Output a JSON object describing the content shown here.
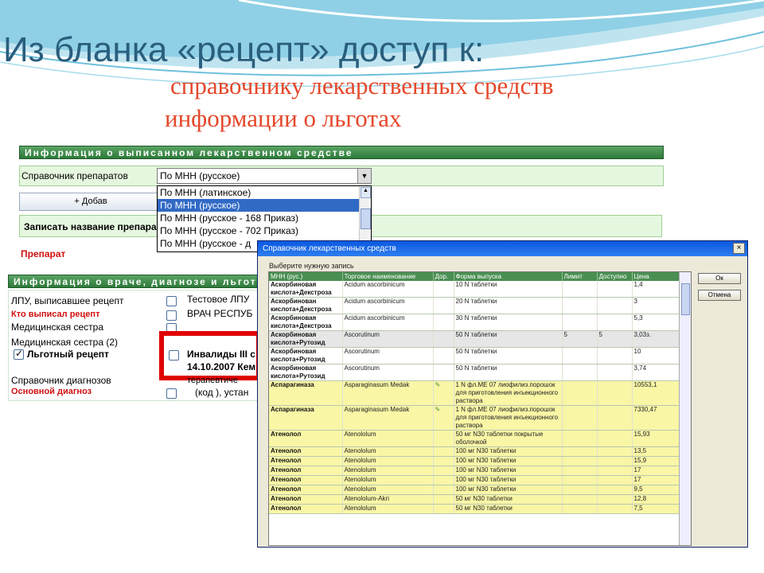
{
  "slide": {
    "title": "Из бланка «рецепт» доступ к:",
    "subtitle1": "справочнику лекарственных средств",
    "subtitle2": "информации о льготах"
  },
  "colors": {
    "title": "#2a5e7d",
    "subtitle": "#e4482a",
    "section_bar": "#3a8a45",
    "highlight_box": "#e00000"
  },
  "drug_section": {
    "header": "Информация о выписанном лекарственном средстве",
    "reference_label": "Справочник препаратов",
    "reference_value": "По МНН (русское)",
    "options": [
      "По МНН (латинское)",
      "По МНН (русское)",
      "По МНН (русское - 168 Приказ)",
      "По МНН (русское - 702 Приказ)",
      "По МНН (русское - д"
    ],
    "selected_index": 1,
    "add_button": "+ Добав",
    "record_label": "Записать название препара",
    "drug_label": "Препарат"
  },
  "doctor_section": {
    "header": "Информация о враче, диагнозе и льготе",
    "lpu_label": "ЛПУ, выписавшее рецепт",
    "lpu_value": "Тестовое ЛПУ",
    "prescriber_label": "Кто выписал рецепт",
    "prescriber_value": "ВРАЧ РЕСПУБ",
    "nurse_label": "Медицинская сестра",
    "nurse2_label": "Медицинская сестра (2)",
    "benefit_label": "Льготный рецепт",
    "benefit_line1": "Инвалиды III с",
    "benefit_line2": "14.10.2007 Кем",
    "diag_ref_label": "Справочник диагнозов",
    "diag_ref_value": "терапевтиче",
    "main_diag_label": "Основной диагноз",
    "main_diag_value": "(код ), устан"
  },
  "dialog": {
    "title": "Справочник лекарственных средств",
    "close": "×",
    "select_label": "Выберите нужную запись",
    "ok": "Ок",
    "cancel": "Отмена",
    "columns": [
      "МНН (рус.)",
      "Торговое наименование",
      "Дор.",
      "Форма выпуска",
      "Лимит",
      "Доступно",
      "Цена"
    ],
    "rows": [
      [
        "Аскорбиновая кислота+Декстроза",
        "Acidum ascorbinicum",
        "",
        "10 N таблетки",
        "",
        "",
        "1,4"
      ],
      [
        "Аскорбинован кислота+Декстроза",
        "Acidum ascorbinicum",
        "",
        "20 N таблетки",
        "",
        "",
        "3"
      ],
      [
        "Аскорбиновая кислота+Декстроза",
        "Acidum ascorbinicum",
        "",
        "30 N таблетки",
        "",
        "",
        "5,3"
      ],
      [
        "Аскорбиновая кислота+Рутозид",
        "Ascorutinum",
        "",
        "50 N таблетки",
        "5",
        "5",
        "3,03з."
      ],
      [
        "Аскорбиновая кислота+Рутозид",
        "Ascorutinum",
        "",
        "50 N таблетки",
        "",
        "",
        "10"
      ],
      [
        "Аскорбиновая кислота+Рутозид",
        "Ascorutinum",
        "",
        "50 N таблетки",
        "",
        "",
        "3,74"
      ],
      [
        "Аспарагиназа",
        "Asparaginasum Medak",
        "",
        "1 N фл.ME 07 лиофилиз.порошок для приготовления инъекционного раствора",
        "",
        "",
        "10553,1"
      ],
      [
        "Аспарагиназа",
        "Asparaginasum Medak",
        "",
        "1 N фл.ME 07 лиофилиз.порошок для приготовления инъекционного раствора",
        "",
        "",
        "7330,47"
      ],
      [
        "Атенолол",
        "Atenololum",
        "",
        "50 мг N30 таблетки покрытые оболочкой",
        "",
        "",
        "15,93"
      ],
      [
        "Атенолол",
        "Atenololum",
        "",
        "100 мг N30 таблетки",
        "",
        "",
        "13,5"
      ],
      [
        "Атенолол",
        "Atenololum",
        "",
        "100 мг N30 таблетки",
        "",
        "",
        "15,9"
      ],
      [
        "Атенолол",
        "Atenololum",
        "",
        "100 мг N30 таблетки",
        "",
        "",
        "17"
      ],
      [
        "Атенолол",
        "Atenololum",
        "",
        "100 мг N30 таблетки",
        "",
        "",
        "17"
      ],
      [
        "Атенолол",
        "Atenololum",
        "",
        "100 мг N30 таблетки",
        "",
        "",
        "9,5"
      ],
      [
        "Атенолол",
        "Atenololum-Akri",
        "",
        "50 мг N30 таблетки",
        "",
        "",
        "12,8"
      ],
      [
        "Атенолол",
        "Atenololum",
        "",
        "50 мг N30 таблетки",
        "",
        "",
        "7,5"
      ]
    ]
  }
}
